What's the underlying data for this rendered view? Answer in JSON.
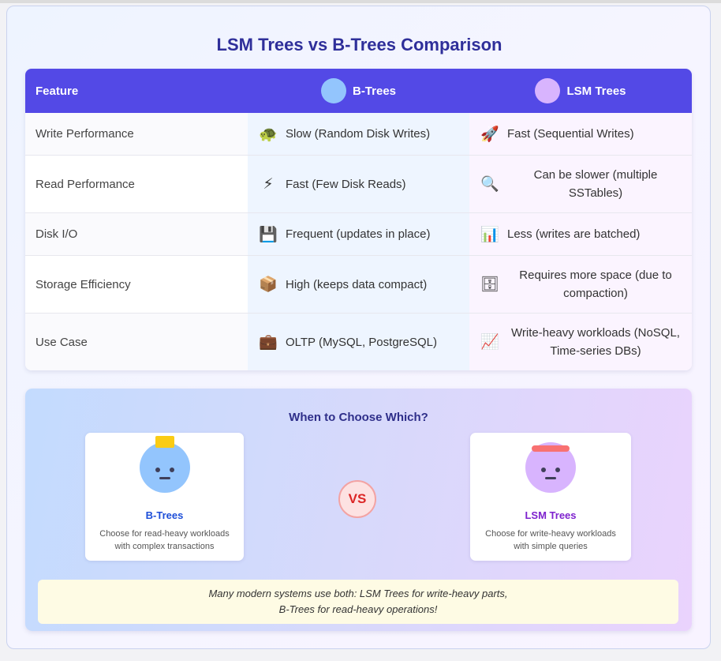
{
  "title": "LSM Trees vs B-Trees Comparison",
  "table": {
    "headers": {
      "feature": "Feature",
      "btrees": "B-Trees",
      "lsm": "LSM Trees"
    },
    "rows": [
      {
        "feature": "Write Performance",
        "b_icon": "🐢",
        "b_icon_name": "turtle-icon",
        "b_text": "Slow (Random Disk Writes)",
        "l_icon": "🚀",
        "l_icon_name": "rocket-icon",
        "l_text": "Fast (Sequential Writes)"
      },
      {
        "feature": "Read Performance",
        "b_icon": "⚡",
        "b_icon_name": "lightning-icon",
        "b_text": "Fast (Few Disk Reads)",
        "l_icon": "🔍",
        "l_icon_name": "magnifier-icon",
        "l_text": "Can be slower (multiple SSTables)"
      },
      {
        "feature": "Disk I/O",
        "b_icon": "💾",
        "b_icon_name": "floppy-disk-icon",
        "b_text": "Frequent (updates in place)",
        "l_icon": "📊",
        "l_icon_name": "bar-chart-icon",
        "l_text": "Less (writes are batched)"
      },
      {
        "feature": "Storage Efficiency",
        "b_icon": "📦",
        "b_icon_name": "package-icon",
        "b_text": "High (keeps data compact)",
        "l_icon": "🗄",
        "l_icon_name": "file-cabinet-icon",
        "l_text": "Requires more space (due to compaction)"
      },
      {
        "feature": "Use Case",
        "b_icon": "💼",
        "b_icon_name": "briefcase-icon",
        "b_text": "OLTP (MySQL, PostgreSQL)",
        "l_icon": "📈",
        "l_icon_name": "trend-chart-icon",
        "l_text": "Write-heavy workloads (NoSQL, Time-series DBs)"
      }
    ]
  },
  "choose": {
    "title": "When to Choose Which?",
    "btrees": {
      "name": "B-Trees",
      "desc_line1": "Choose for read-heavy workloads",
      "desc_line2": "with complex transactions"
    },
    "lsm": {
      "name": "LSM Trees",
      "desc_line1": "Choose for write-heavy workloads",
      "desc_line2": "with simple queries"
    },
    "vs": "VS",
    "note_line1": "Many modern systems use both: LSM Trees for write-heavy parts,",
    "note_line2": "B-Trees for read-heavy operations!"
  },
  "colors": {
    "header": "#5349e6",
    "btree": "#93c5fd",
    "lsm": "#d8b4fe",
    "title": "#2f2f9a"
  }
}
